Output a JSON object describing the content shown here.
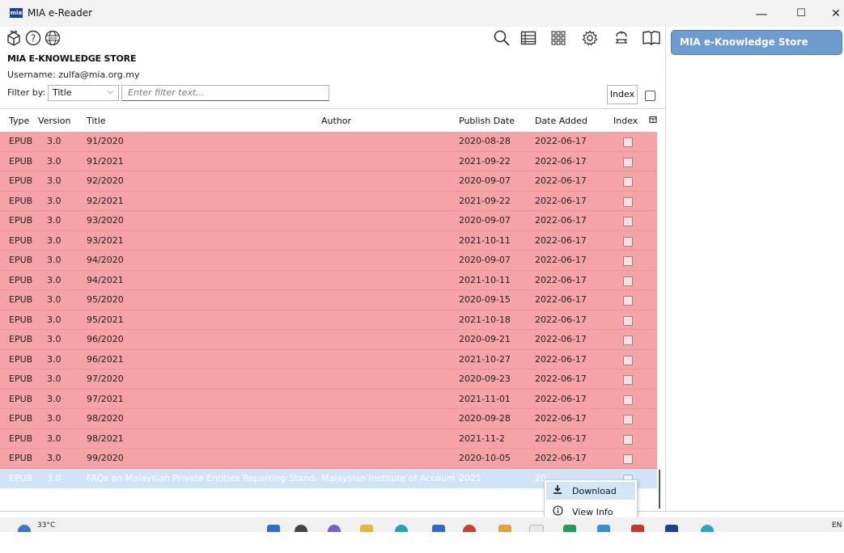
{
  "window": {
    "title": "MIA e-Reader",
    "app_icon_text": "mia",
    "minimize": "—",
    "maximize": "☐",
    "close": "✕"
  },
  "toolbar": {
    "home_icon": "box-icon",
    "help_icon": "help-circle-icon",
    "web_icon": "globe-www-icon",
    "right_icons": [
      "search-icon",
      "list-view-icon",
      "grid-view-icon",
      "settings-gear-icon",
      "sync-user-icon",
      "book-icon"
    ]
  },
  "store": {
    "name": "MIA E-KNOWLEDGE STORE",
    "username": "Username: zulfa@mia.org.my"
  },
  "filter": {
    "label": "Filter by:",
    "selected": "Title",
    "placeholder": "Enter filter text...",
    "index_button": "Index"
  },
  "table": {
    "columns": [
      "Type",
      "Version",
      "Title",
      "Author",
      "Publish Date",
      "Date Added",
      "Index"
    ],
    "rows": [
      {
        "type": "EPUB",
        "version": "3.0",
        "title": "91/2020",
        "author": "",
        "publish": "2020-08-28",
        "added": "2022-06-17"
      },
      {
        "type": "EPUB",
        "version": "3.0",
        "title": "91/2021",
        "author": "",
        "publish": "2021-09-22",
        "added": "2022-06-17"
      },
      {
        "type": "EPUB",
        "version": "3.0",
        "title": "92/2020",
        "author": "",
        "publish": "2020-09-07",
        "added": "2022-06-17"
      },
      {
        "type": "EPUB",
        "version": "3.0",
        "title": "92/2021",
        "author": "",
        "publish": "2021-09-22",
        "added": "2022-06-17"
      },
      {
        "type": "EPUB",
        "version": "3.0",
        "title": "93/2020",
        "author": "",
        "publish": "2020-09-07",
        "added": "2022-06-17"
      },
      {
        "type": "EPUB",
        "version": "3.0",
        "title": "93/2021",
        "author": "",
        "publish": "2021-10-11",
        "added": "2022-06-17"
      },
      {
        "type": "EPUB",
        "version": "3.0",
        "title": "94/2020",
        "author": "",
        "publish": "2020-09-07",
        "added": "2022-06-17"
      },
      {
        "type": "EPUB",
        "version": "3.0",
        "title": "94/2021",
        "author": "",
        "publish": "2021-10-11",
        "added": "2022-06-17"
      },
      {
        "type": "EPUB",
        "version": "3.0",
        "title": "95/2020",
        "author": "",
        "publish": "2020-09-15",
        "added": "2022-06-17"
      },
      {
        "type": "EPUB",
        "version": "3.0",
        "title": "95/2021",
        "author": "",
        "publish": "2021-10-18",
        "added": "2022-06-17"
      },
      {
        "type": "EPUB",
        "version": "3.0",
        "title": "96/2020",
        "author": "",
        "publish": "2020-09-21",
        "added": "2022-06-17"
      },
      {
        "type": "EPUB",
        "version": "3.0",
        "title": "96/2021",
        "author": "",
        "publish": "2021-10-27",
        "added": "2022-06-17"
      },
      {
        "type": "EPUB",
        "version": "3.0",
        "title": "97/2020",
        "author": "",
        "publish": "2020-09-23",
        "added": "2022-06-17"
      },
      {
        "type": "EPUB",
        "version": "3.0",
        "title": "97/2021",
        "author": "",
        "publish": "2021-11-01",
        "added": "2022-06-17"
      },
      {
        "type": "EPUB",
        "version": "3.0",
        "title": "98/2020",
        "author": "",
        "publish": "2020-09-28",
        "added": "2022-06-17"
      },
      {
        "type": "EPUB",
        "version": "3.0",
        "title": "98/2021",
        "author": "",
        "publish": "2021-11-2",
        "added": "2022-06-17"
      },
      {
        "type": "EPUB",
        "version": "3.0",
        "title": "99/2020",
        "author": "",
        "publish": "2020-10-05",
        "added": "2022-06-17"
      },
      {
        "type": "EPUB",
        "version": "3.0",
        "title": "FAQs on Malaysian Private Entities Reporting Standar...",
        "author": "Malaysian Institute of Accounta...",
        "publish": "2021",
        "added": "20",
        "selected": true
      }
    ]
  },
  "right_panel": {
    "store_button": "MIA e-Knowledge Store"
  },
  "context_menu": {
    "items": [
      {
        "label": "Download",
        "icon": "download-icon"
      },
      {
        "label": "View Info",
        "icon": "info-icon"
      }
    ]
  },
  "taskbar": {
    "temperature": "33°C",
    "lang": "EN"
  }
}
